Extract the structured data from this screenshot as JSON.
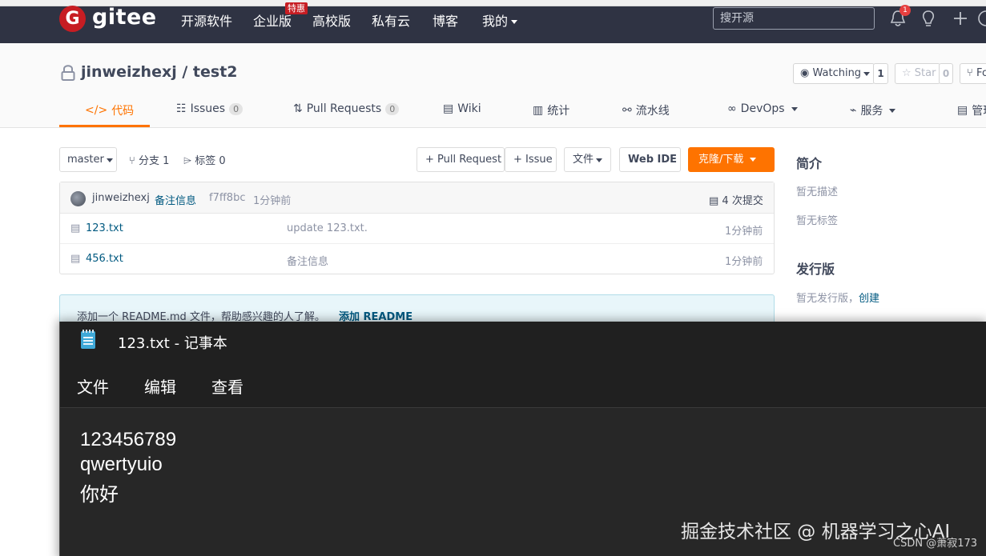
{
  "nav": {
    "logo_letter": "G",
    "logo_text": "gitee",
    "items": [
      "开源软件",
      "企业版",
      "高校版",
      "私有云",
      "博客",
      "我的"
    ],
    "badge": "特惠",
    "search_placeholder": "搜开源",
    "notification_count": "1"
  },
  "repo": {
    "title": "jinweizhexj / test2",
    "watch_label": "Watching",
    "watch_count": "1",
    "star_label": "Star",
    "star_count": "0",
    "fork_label": "Fo",
    "tabs": [
      {
        "label": "代码",
        "icon": "code-icon"
      },
      {
        "label": "Issues",
        "count": "0"
      },
      {
        "label": "Pull Requests",
        "count": "0"
      },
      {
        "label": "Wiki"
      },
      {
        "label": "统计"
      },
      {
        "label": "流水线"
      },
      {
        "label": "DevOps"
      },
      {
        "label": "服务"
      },
      {
        "label": "管理"
      }
    ]
  },
  "toolbar": {
    "branch": "master",
    "branches": "分支 1",
    "tags": "标签 0",
    "pull_request": "+ Pull Request",
    "issue": "+ Issue",
    "file": "文件",
    "web_ide": "Web IDE",
    "clone": "克隆/下载"
  },
  "commit": {
    "author": "jinweizhexj",
    "message": "备注信息",
    "hash": "f7ff8bc",
    "time": "1分钟前",
    "commits": "4 次提交"
  },
  "files": [
    {
      "name": "123.txt",
      "message": "update 123.txt.",
      "time": "1分钟前"
    },
    {
      "name": "456.txt",
      "message": "备注信息",
      "time": "1分钟前"
    }
  ],
  "sidebar": {
    "intro_title": "简介",
    "no_desc": "暂无描述",
    "no_tags": "暂无标签",
    "release_title": "发行版",
    "no_release": "暂无发行版，",
    "create": "创建"
  },
  "readme_notice": {
    "text": "添加一个 README.md 文件，帮助感兴趣的人了解。",
    "link": "添加 README"
  },
  "notepad": {
    "title": "123.txt - 记事本",
    "menu": [
      "文件",
      "编辑",
      "查看"
    ],
    "lines": [
      "123456789",
      "qwertyuio",
      "你好"
    ]
  },
  "watermark": "掘金技术社区 @ 机器学习之心AI",
  "csdn_mark": "CSDN @萧寂173",
  "colors": {
    "nav_bg": "#2f3343",
    "accent": "#fe7300",
    "brand_red": "#c71d23",
    "link": "#005980"
  }
}
